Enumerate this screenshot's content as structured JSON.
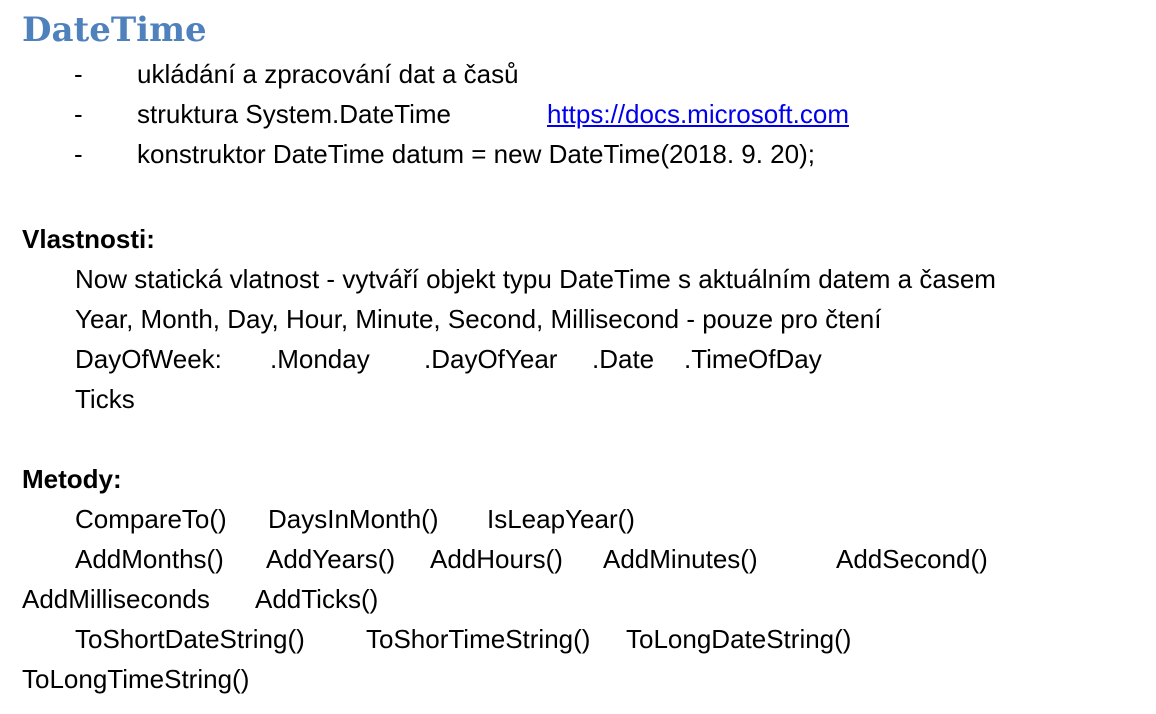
{
  "title": "DateTime",
  "bullets": [
    {
      "dash": "-",
      "text": "ukládání a zpracování dat a časů"
    },
    {
      "dash": "-",
      "text": "struktura System.DateTime",
      "link": "https://docs.microsoft.com"
    },
    {
      "dash": "-",
      "text": "konstruktor DateTime datum = new DateTime(2018. 9. 20);"
    }
  ],
  "properties": {
    "heading": "Vlastnosti:",
    "lines": [
      "Now statická vlatnost - vytváří objekt typu DateTime s aktuálním datem a časem",
      "Year, Month, Day, Hour, Minute, Second, Millisecond - pouze pro čtení"
    ],
    "dayofweek": {
      "label": "DayOfWeek:",
      "items": [
        ".Monday",
        ".DayOfYear",
        ".Date",
        ".TimeOfDay"
      ]
    },
    "ticks": "Ticks"
  },
  "methods": {
    "heading": "Metody:",
    "row1": [
      "CompareTo()",
      "DaysInMonth()",
      "IsLeapYear()"
    ],
    "row2": [
      "AddMonths()",
      "AddYears()",
      "AddHours()",
      "AddMinutes()",
      "AddSecond()"
    ],
    "row3": [
      "AddMilliseconds",
      "AddTicks()"
    ],
    "row4": [
      "ToShortDateString()",
      "ToShorTimeString()",
      "ToLongDateString()"
    ],
    "row5": [
      "ToLongTimeString()"
    ]
  }
}
